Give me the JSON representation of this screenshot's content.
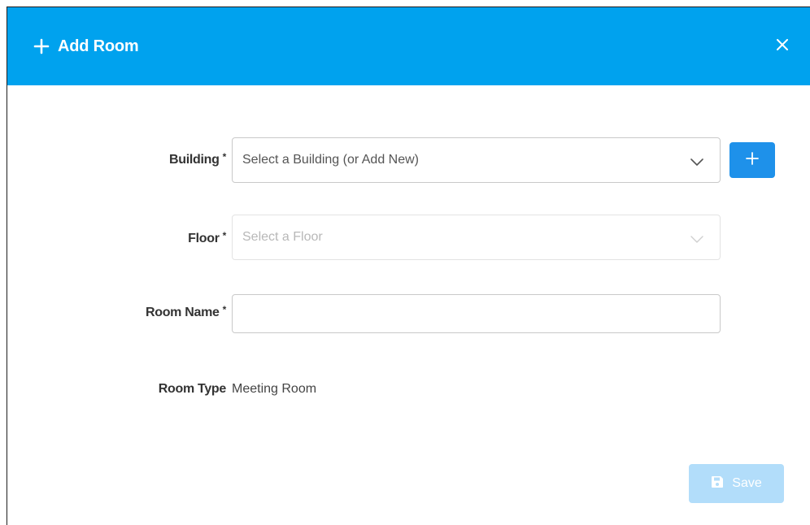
{
  "dialog": {
    "title": "Add Room",
    "title_icon": "plus-icon",
    "close_icon": "close-icon",
    "header_color": "#00a2ee"
  },
  "form": {
    "building": {
      "label": "Building",
      "required_mark": "*",
      "placeholder": "Select a Building (or Add New)",
      "icon": "chevron-down-icon"
    },
    "add_building_button": {
      "icon": "plus-icon",
      "color": "#1e91ea"
    },
    "floor": {
      "label": "Floor",
      "required_mark": "*",
      "placeholder": "Select a Floor",
      "disabled": true,
      "icon": "chevron-down-icon"
    },
    "room_name": {
      "label": "Room Name",
      "required_mark": "*",
      "value": ""
    },
    "room_type": {
      "label": "Room Type",
      "value": "Meeting Room"
    }
  },
  "footer": {
    "save_label": "Save",
    "save_icon": "floppy-disk-icon",
    "save_disabled": true,
    "save_color": "#b2ddfa"
  }
}
